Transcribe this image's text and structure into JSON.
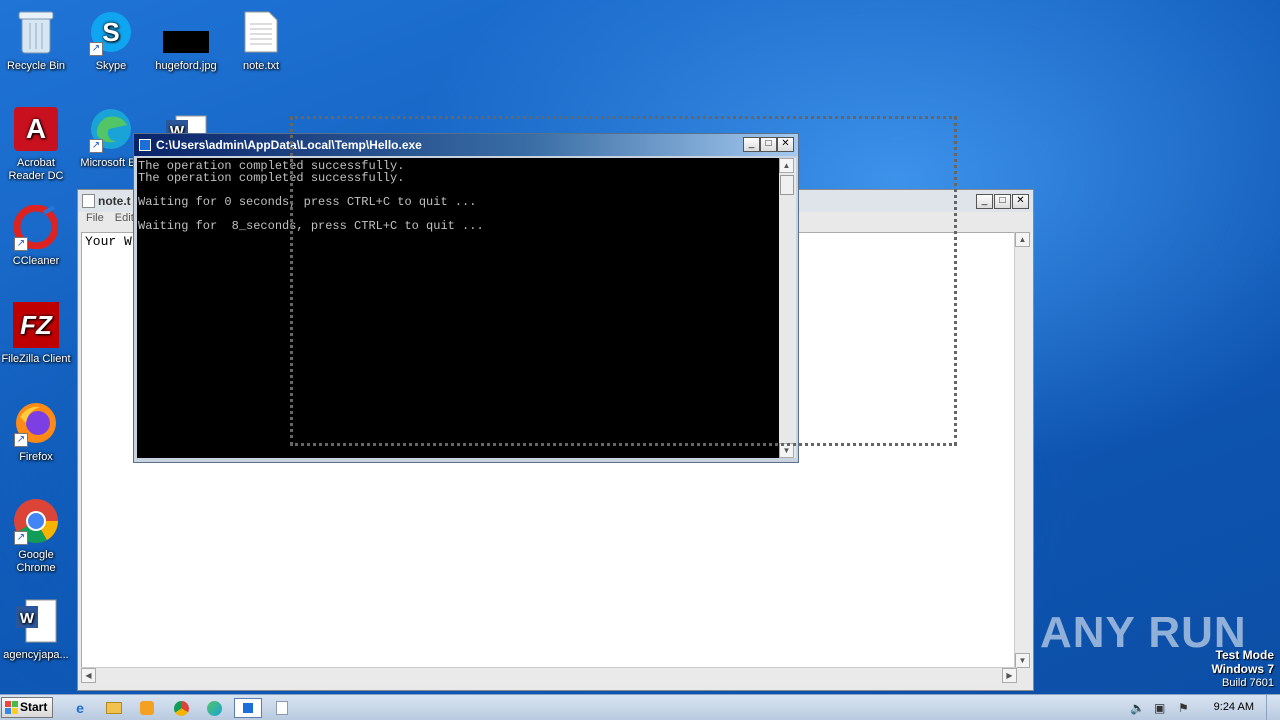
{
  "desktop": {
    "icons": [
      {
        "label": "Recycle Bin",
        "icon": "recycle-bin-icon"
      },
      {
        "label": "Skype",
        "icon": "skype-icon"
      },
      {
        "label": "hugeford.jpg",
        "icon": "image-file-icon"
      },
      {
        "label": "note.txt",
        "icon": "text-file-icon"
      },
      {
        "label": "Acrobat Reader DC",
        "icon": "acrobat-icon"
      },
      {
        "label": "Microsoft Ed",
        "icon": "edge-icon"
      },
      {
        "label": "CCleaner",
        "icon": "ccleaner-icon"
      },
      {
        "label": "FileZilla Client",
        "icon": "filezilla-icon"
      },
      {
        "label": "Firefox",
        "icon": "firefox-icon"
      },
      {
        "label": "Google Chrome",
        "icon": "chrome-icon"
      },
      {
        "label": "agencyjapa...",
        "icon": "word-doc-icon"
      }
    ]
  },
  "notepad": {
    "title": "note.t",
    "menu": [
      "File",
      "Edit"
    ],
    "content": "Your W"
  },
  "console": {
    "title": "C:\\Users\\admin\\AppData\\Local\\Temp\\Hello.exe",
    "lines": [
      "The operation completed successfully.",
      "The operation completed successfully.",
      "",
      "Waiting for 0 seconds, press CTRL+C to quit ...",
      "",
      "Waiting for  8_seconds, press CTRL+C to quit ..."
    ]
  },
  "watermark": {
    "brand": "ANY RUN",
    "test_mode": "Test Mode",
    "os": "Windows 7",
    "build": "Build 7601"
  },
  "taskbar": {
    "start_label": "Start",
    "clock": "9:24 AM",
    "apps": [
      "ie-icon",
      "explorer-icon",
      "media-player-icon",
      "chrome-icon",
      "edge-icon",
      "console-icon",
      "notepad-icon"
    ]
  },
  "colors": {
    "desktop": "#1465c8",
    "console_bg": "#000000",
    "console_text": "#c0c0c0",
    "console_title": "#0a246a"
  }
}
